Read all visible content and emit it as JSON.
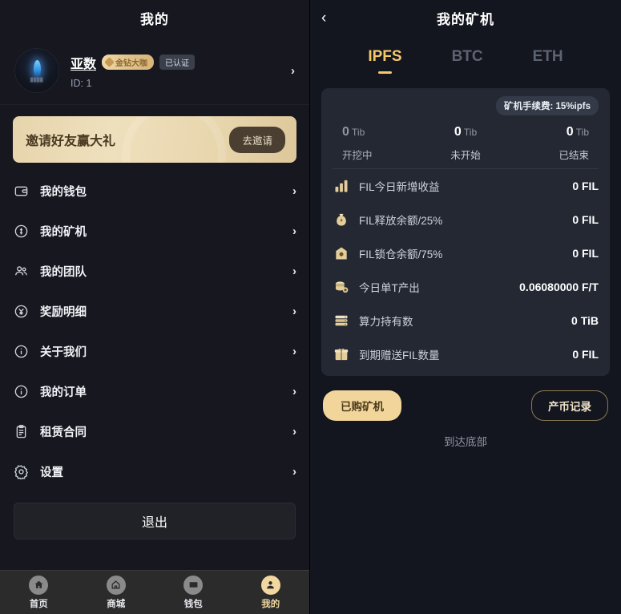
{
  "left": {
    "title": "我的",
    "profile": {
      "name": "亚数",
      "vip_badge": "金钻大咖",
      "verified_badge": "已认证",
      "id_label": "ID: 1",
      "chevron": "›"
    },
    "banner": {
      "text": "邀请好友赢大礼",
      "button": "去邀请"
    },
    "menu": [
      {
        "label": "我的钱包",
        "icon": "wallet-icon",
        "chevron": "›"
      },
      {
        "label": "我的矿机",
        "icon": "miner-icon",
        "chevron": "›"
      },
      {
        "label": "我的团队",
        "icon": "team-icon",
        "chevron": "›"
      },
      {
        "label": "奖励明细",
        "icon": "reward-icon",
        "chevron": "›"
      },
      {
        "label": "关于我们",
        "icon": "info-icon",
        "chevron": "›"
      },
      {
        "label": "我的订单",
        "icon": "order-icon",
        "chevron": "›"
      },
      {
        "label": "租赁合同",
        "icon": "contract-icon",
        "chevron": "›"
      },
      {
        "label": "设置",
        "icon": "gear-icon",
        "chevron": "›"
      }
    ],
    "logout": "退出",
    "tabbar": [
      {
        "label": "首页",
        "icon": "home-icon",
        "active": false
      },
      {
        "label": "商城",
        "icon": "shop-icon",
        "active": false
      },
      {
        "label": "钱包",
        "icon": "wallet-icon",
        "active": false
      },
      {
        "label": "我的",
        "icon": "user-icon",
        "active": true
      }
    ]
  },
  "right": {
    "back_icon": "‹",
    "title": "我的矿机",
    "tabs": [
      {
        "label": "IPFS",
        "active": true
      },
      {
        "label": "BTC",
        "active": false
      },
      {
        "label": "ETH",
        "active": false
      }
    ],
    "fee_badge": "矿机手续费: 15%ipfs",
    "stats": [
      {
        "value": "0",
        "unit": "Tib",
        "label": "开挖中",
        "dim": true
      },
      {
        "value": "0",
        "unit": "Tib",
        "label": "未开始",
        "dim": false
      },
      {
        "value": "0",
        "unit": "Tib",
        "label": "已结束",
        "dim": false
      }
    ],
    "rows": [
      {
        "icon": "bar-chart-icon",
        "label": "FIL今日新增收益",
        "value": "0 FIL"
      },
      {
        "icon": "money-bag-icon",
        "label": "FIL释放余额/25%",
        "value": "0 FIL"
      },
      {
        "icon": "lock-vault-icon",
        "label": "FIL锁仓余额/75%",
        "value": "0 FIL"
      },
      {
        "icon": "coins-plus-icon",
        "label": "今日单T产出",
        "value": "0.06080000 F/T"
      },
      {
        "icon": "server-stack-icon",
        "label": "算力持有数",
        "value": "0 TiB"
      },
      {
        "icon": "gift-box-icon",
        "label": "到期赠送FIL数量",
        "value": "0 FIL"
      }
    ],
    "actions": {
      "purchased": "已购矿机",
      "record": "产币记录"
    },
    "bottom_note": "到达底部"
  },
  "colors": {
    "accent_gold": "#f5c86a",
    "banner_gold": "#e6d4ac",
    "panel_bg": "#16171f",
    "card_bg": "#242833"
  }
}
